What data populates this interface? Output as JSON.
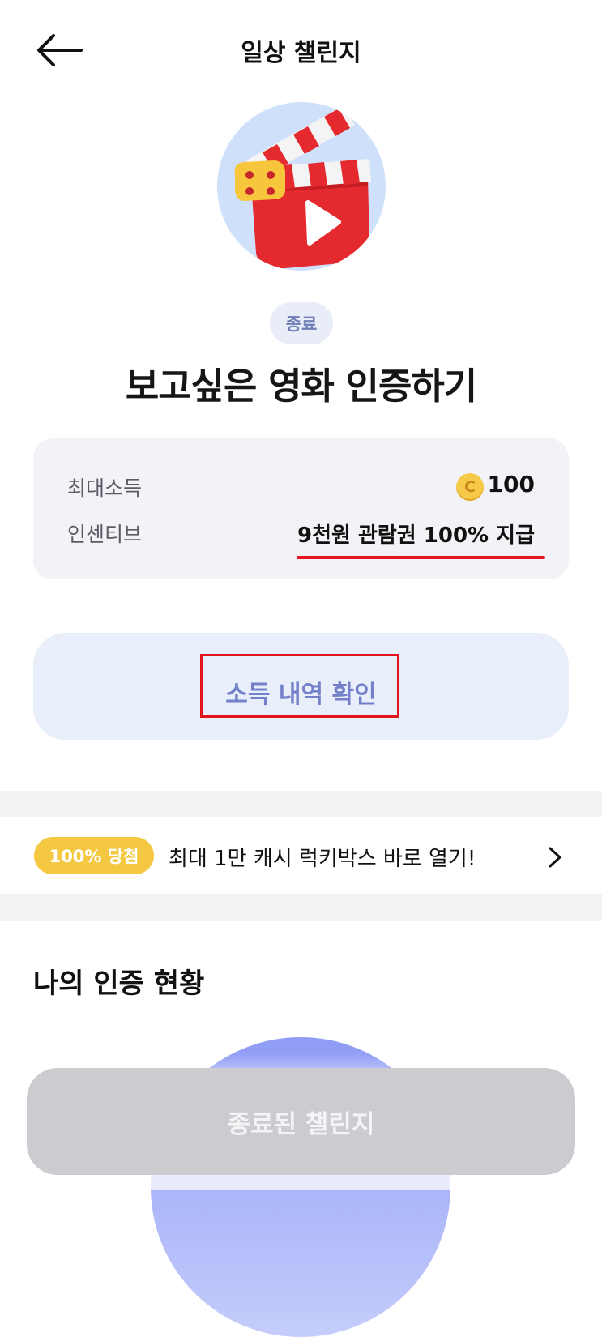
{
  "header": {
    "title": "일상 챌린지",
    "back_icon": "arrow-left-icon"
  },
  "hero": {
    "icon": "movie-clapperboard-icon"
  },
  "challenge": {
    "status": "종료",
    "title": "보고싶은 영화 인증하기"
  },
  "info": {
    "max_income_label": "최대소득",
    "max_income_value": "100",
    "coin_letter": "C",
    "incentive_label": "인센티브",
    "incentive_value": "9천원 관람권 100% 지급"
  },
  "history_button": {
    "label": "소득 내역 확인"
  },
  "promo": {
    "badge": "100% 당첨",
    "text": "최대 1만 캐시 럭키박스 바로 열기!",
    "chevron_icon": "chevron-right-icon"
  },
  "my_status": {
    "title": "나의 인증 현황"
  },
  "bottom_button": {
    "label": "종료된 챌린지"
  },
  "colors": {
    "accent_blue": "#7480c9",
    "badge_yellow": "#f5c842",
    "annotation_red": "#e2131b",
    "disabled_gray": "#ccccd0"
  }
}
